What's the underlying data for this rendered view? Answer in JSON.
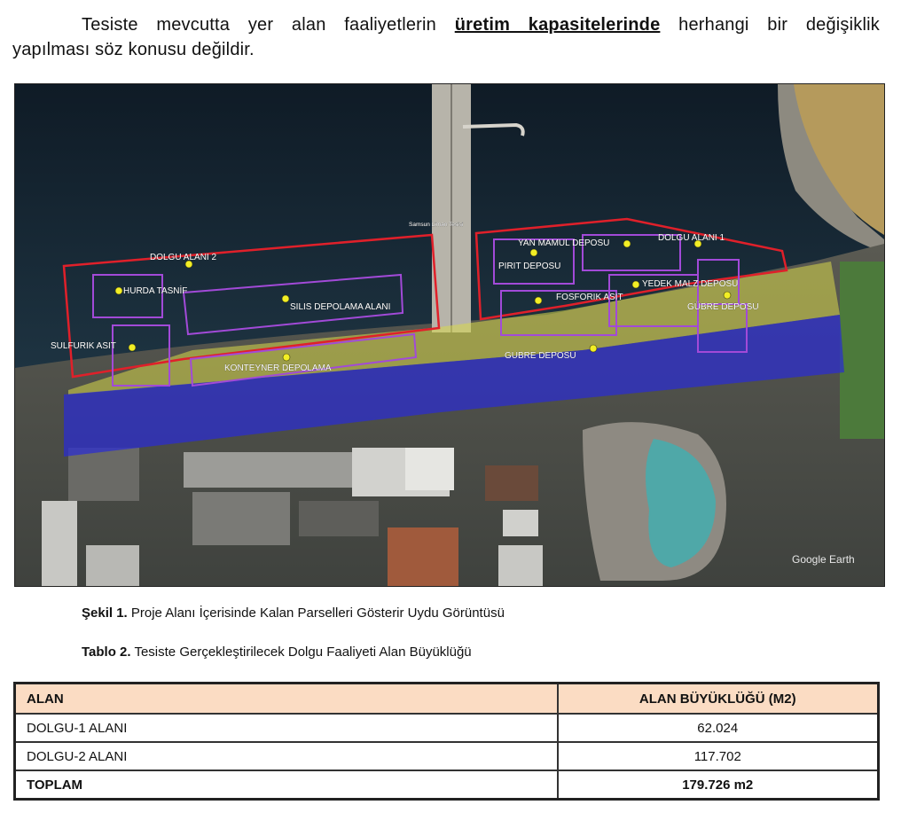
{
  "paragraph": {
    "line1_pre": "Tesiste mevcutta yer alan faaliyetlerin",
    "line1_bold": "üretim kapasitelerinde",
    "line1_post": "herhangi bir değişiklik",
    "line2": "yapılması söz konusu değildir."
  },
  "map": {
    "labels": {
      "dolgu2": "DOLGU ALANI 2",
      "dolgu1": "DOLGU ALANI 1",
      "hurda": "HURDA TASNİF",
      "silis": "SILIS DEPOLAMA ALANI",
      "sulfurik": "SULFURIK ASIT",
      "pirit": "PIRIT DEPOSU",
      "yanmamul": "YAN MAMUL DEPOSU",
      "yedek": "YEDEK MALZ DEPOSU",
      "fosforik": "FOSFORIK ASIT",
      "gubre": "GUBRE DEPOSU",
      "gubre2": "GÜBRE DEPOSU",
      "konteyner": "KONTEYNER DEPOLAMA",
      "jetty": "Samsun Liman Tesisi",
      "watermark": "Google Earth"
    },
    "colors": {
      "sea": "#14222f",
      "land": "#4a4d48",
      "red_outline": "#e0202a",
      "purple_outline": "#a24ad8",
      "yellow_fill": "#d9d84a",
      "blue_fill": "#2a2bd6",
      "pin": "#f2ee25"
    }
  },
  "captions": {
    "fig_label": "Şekil 1.",
    "fig_text": "Proje Alanı İçerisinde Kalan Parselleri Gösterir Uydu Görüntüsü",
    "table_label": "Tablo 2.",
    "table_text": "Tesiste Gerçekleştirilecek Dolgu Faaliyeti Alan Büyüklüğü"
  },
  "table": {
    "headers": [
      "ALAN",
      "ALAN BÜYÜKLÜĞÜ (M2)"
    ],
    "rows": [
      {
        "name": "DOLGU-1 ALANI",
        "value": "62.024"
      },
      {
        "name": "DOLGU-2 ALANI",
        "value": "117.702"
      }
    ],
    "total": {
      "name": "TOPLAM",
      "value": "179.726 m2"
    }
  }
}
